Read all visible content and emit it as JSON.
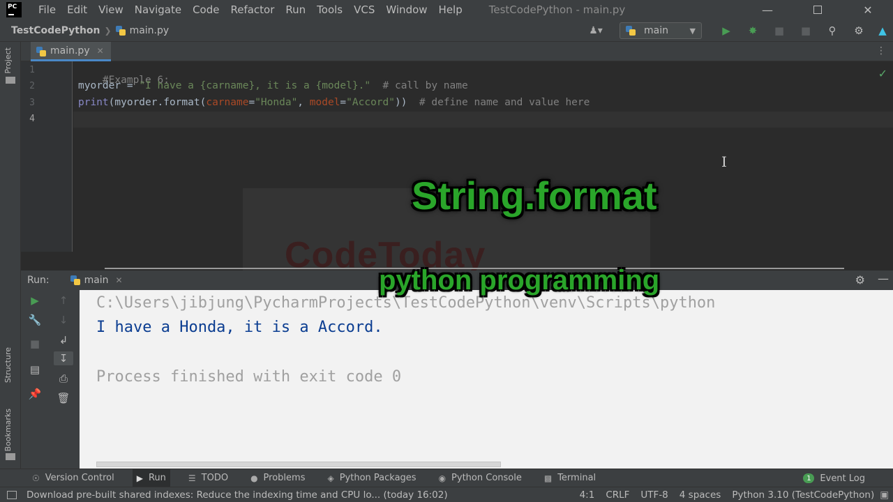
{
  "titlebar": {
    "logo_text": "PC",
    "menu": [
      "File",
      "Edit",
      "View",
      "Navigate",
      "Code",
      "Refactor",
      "Run",
      "Tools",
      "VCS",
      "Window",
      "Help"
    ],
    "title": "TestCodePython - main.py"
  },
  "navbar": {
    "project": "TestCodePython",
    "file": "main.py",
    "run_config": "main"
  },
  "left_strip": {
    "project_label": "Project",
    "structure_label": "Structure",
    "bookmarks_label": "Bookmarks"
  },
  "editor": {
    "tab_label": "main.py",
    "line_numbers": [
      "1",
      "2",
      "3",
      "4"
    ],
    "line1": "#Example 6:",
    "line2_code": "myorder = ",
    "line2_str": "\"I have a {carname}, it is a {model}.\"",
    "line2_comment": "  # call by name",
    "line3_fn": "print",
    "line3_a": "(myorder.format(",
    "line3_kw1": "carname",
    "line3_eq1": "=",
    "line3_str1": "\"Honda\"",
    "line3_sep": ", ",
    "line3_kw2": "model",
    "line3_eq2": "=",
    "line3_str2": "\"Accord\"",
    "line3_b": "))",
    "line3_comment": "  # define name and value here"
  },
  "overlay": {
    "title": "String.format",
    "subtitle": "python programming",
    "watermark": "CodeToday"
  },
  "run_panel": {
    "label": "Run:",
    "tab_label": "main",
    "console": {
      "command": "C:\\Users\\jibjung\\PycharmProjects\\TestCodePython\\venv\\Scripts\\python",
      "output": "I have a Honda, it is a Accord.",
      "exit": "Process finished with exit code 0"
    }
  },
  "bottom_tools": {
    "version_control": "Version Control",
    "run": "Run",
    "todo": "TODO",
    "problems": "Problems",
    "python_packages": "Python Packages",
    "python_console": "Python Console",
    "terminal": "Terminal",
    "event_log": "Event Log",
    "event_count": "1"
  },
  "statusbar": {
    "message": "Download pre-built shared indexes: Reduce the indexing time and CPU lo... (today 16:02)",
    "position": "4:1",
    "line_sep": "CRLF",
    "encoding": "UTF-8",
    "indent": "4 spaces",
    "interpreter": "Python 3.10 (TestCodePython)"
  },
  "colors": {
    "accent_green": "#2aa52a",
    "console_output": "#0b3d91",
    "console_gray": "#a0a0a0"
  }
}
